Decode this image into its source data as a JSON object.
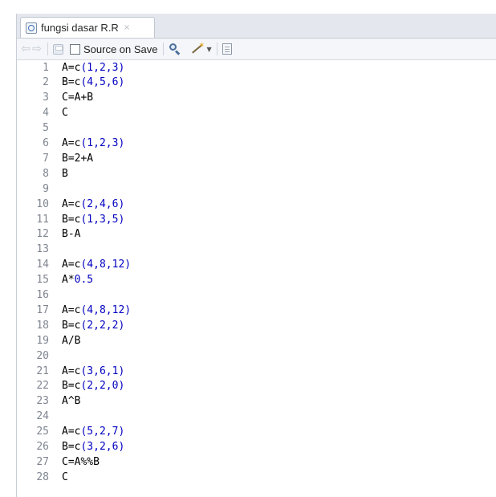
{
  "tab": {
    "label": "fungsi dasar R.R",
    "close_glyph": "×",
    "icon": "r-script-icon"
  },
  "toolbar": {
    "back_icon": "arrow-left-icon",
    "forward_icon": "arrow-right-icon",
    "save_icon": "save-icon",
    "source_on_save_label": "Source on Save",
    "source_on_save_checked": false,
    "search_icon": "search-icon",
    "code_tools_icon": "magic-wand-icon",
    "compile_icon": "notebook-icon"
  },
  "colors": {
    "number": "#0000c0",
    "identifier": "#000000",
    "line_number": "#7f8590",
    "tabbar_bg": "#e4e8ee"
  },
  "editor": {
    "lines": [
      {
        "num": "1",
        "tokens": [
          {
            "t": "A=c",
            "k": "id"
          },
          {
            "t": "(1,2,3)",
            "k": "num"
          }
        ]
      },
      {
        "num": "2",
        "tokens": [
          {
            "t": "B=c",
            "k": "id"
          },
          {
            "t": "(4,5,6)",
            "k": "num"
          }
        ]
      },
      {
        "num": "3",
        "tokens": [
          {
            "t": "C=A+B",
            "k": "id"
          }
        ]
      },
      {
        "num": "4",
        "tokens": [
          {
            "t": "C",
            "k": "id"
          }
        ]
      },
      {
        "num": "5",
        "tokens": []
      },
      {
        "num": "6",
        "tokens": [
          {
            "t": "A=c",
            "k": "id"
          },
          {
            "t": "(1,2,3)",
            "k": "num"
          }
        ]
      },
      {
        "num": "7",
        "tokens": [
          {
            "t": "B=2+A",
            "k": "id"
          }
        ]
      },
      {
        "num": "8",
        "tokens": [
          {
            "t": "B",
            "k": "id"
          }
        ]
      },
      {
        "num": "9",
        "tokens": []
      },
      {
        "num": "10",
        "tokens": [
          {
            "t": "A=c",
            "k": "id"
          },
          {
            "t": "(2,4,6)",
            "k": "num"
          }
        ]
      },
      {
        "num": "11",
        "tokens": [
          {
            "t": "B=c",
            "k": "id"
          },
          {
            "t": "(1,3,5)",
            "k": "num"
          }
        ]
      },
      {
        "num": "12",
        "tokens": [
          {
            "t": "B-A",
            "k": "id"
          }
        ]
      },
      {
        "num": "13",
        "tokens": []
      },
      {
        "num": "14",
        "tokens": [
          {
            "t": "A=c",
            "k": "id"
          },
          {
            "t": "(4,8,12)",
            "k": "num"
          }
        ]
      },
      {
        "num": "15",
        "tokens": [
          {
            "t": "A*",
            "k": "id"
          },
          {
            "t": "0.5",
            "k": "num"
          }
        ]
      },
      {
        "num": "16",
        "tokens": []
      },
      {
        "num": "17",
        "tokens": [
          {
            "t": "A=c",
            "k": "id"
          },
          {
            "t": "(4,8,12)",
            "k": "num"
          }
        ]
      },
      {
        "num": "18",
        "tokens": [
          {
            "t": "B=c",
            "k": "id"
          },
          {
            "t": "(2,2,2)",
            "k": "num"
          }
        ]
      },
      {
        "num": "19",
        "tokens": [
          {
            "t": "A/B",
            "k": "id"
          }
        ]
      },
      {
        "num": "20",
        "tokens": []
      },
      {
        "num": "21",
        "tokens": [
          {
            "t": "A=c",
            "k": "id"
          },
          {
            "t": "(3,6,1)",
            "k": "num"
          }
        ]
      },
      {
        "num": "22",
        "tokens": [
          {
            "t": "B=c",
            "k": "id"
          },
          {
            "t": "(2,2,0)",
            "k": "num"
          }
        ]
      },
      {
        "num": "23",
        "tokens": [
          {
            "t": "A^B",
            "k": "id"
          }
        ]
      },
      {
        "num": "24",
        "tokens": []
      },
      {
        "num": "25",
        "tokens": [
          {
            "t": "A=c",
            "k": "id"
          },
          {
            "t": "(5,2,7)",
            "k": "num"
          }
        ]
      },
      {
        "num": "26",
        "tokens": [
          {
            "t": "B=c",
            "k": "id"
          },
          {
            "t": "(3,2,6)",
            "k": "num"
          }
        ]
      },
      {
        "num": "27",
        "tokens": [
          {
            "t": "C=A%%B",
            "k": "id"
          }
        ]
      },
      {
        "num": "28",
        "tokens": [
          {
            "t": "C",
            "k": "id"
          }
        ]
      }
    ]
  }
}
